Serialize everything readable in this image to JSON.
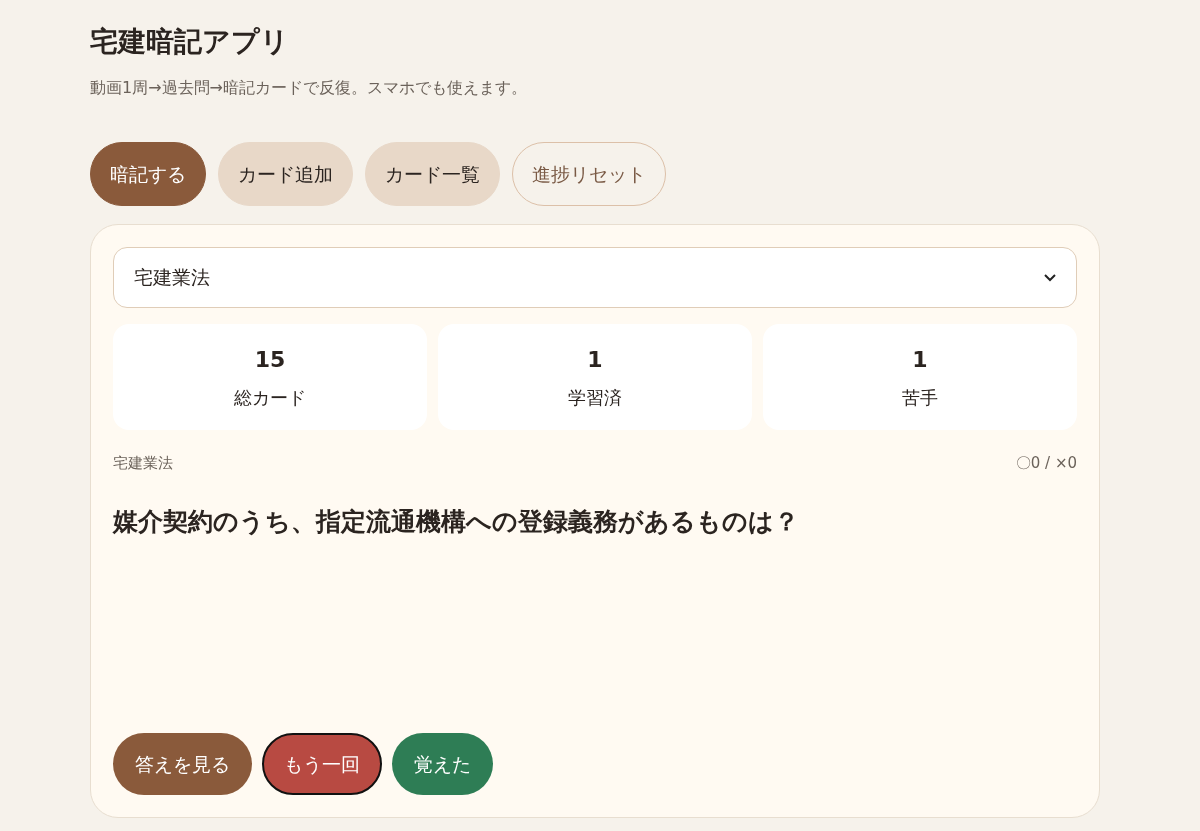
{
  "app": {
    "title": "宅建暗記アプリ",
    "subtitle": "動画1周→過去問→暗記カードで反復。スマホでも使えます。"
  },
  "tabs": [
    {
      "label": "暗記する",
      "kind": "tab",
      "selected": true
    },
    {
      "label": "カード追加",
      "kind": "tab",
      "selected": false
    },
    {
      "label": "カード一覧",
      "kind": "tab",
      "selected": false
    },
    {
      "label": "進捗リセット",
      "kind": "reset",
      "selected": false
    }
  ],
  "category_select": {
    "value": "宅建業法"
  },
  "stats": [
    {
      "value": "15",
      "label": "総カード"
    },
    {
      "value": "1",
      "label": "学習済"
    },
    {
      "value": "1",
      "label": "苦手"
    }
  ],
  "card": {
    "category": "宅建業法",
    "score": "〇0 / ×0",
    "question": "媒介契約のうち、指定流通機構への登録義務があるものは？"
  },
  "actions": [
    {
      "label": "答えを見る",
      "kind": "show",
      "focused": false
    },
    {
      "label": "もう一回",
      "kind": "again",
      "focused": true
    },
    {
      "label": "覚えた",
      "kind": "remember",
      "focused": false
    }
  ]
}
